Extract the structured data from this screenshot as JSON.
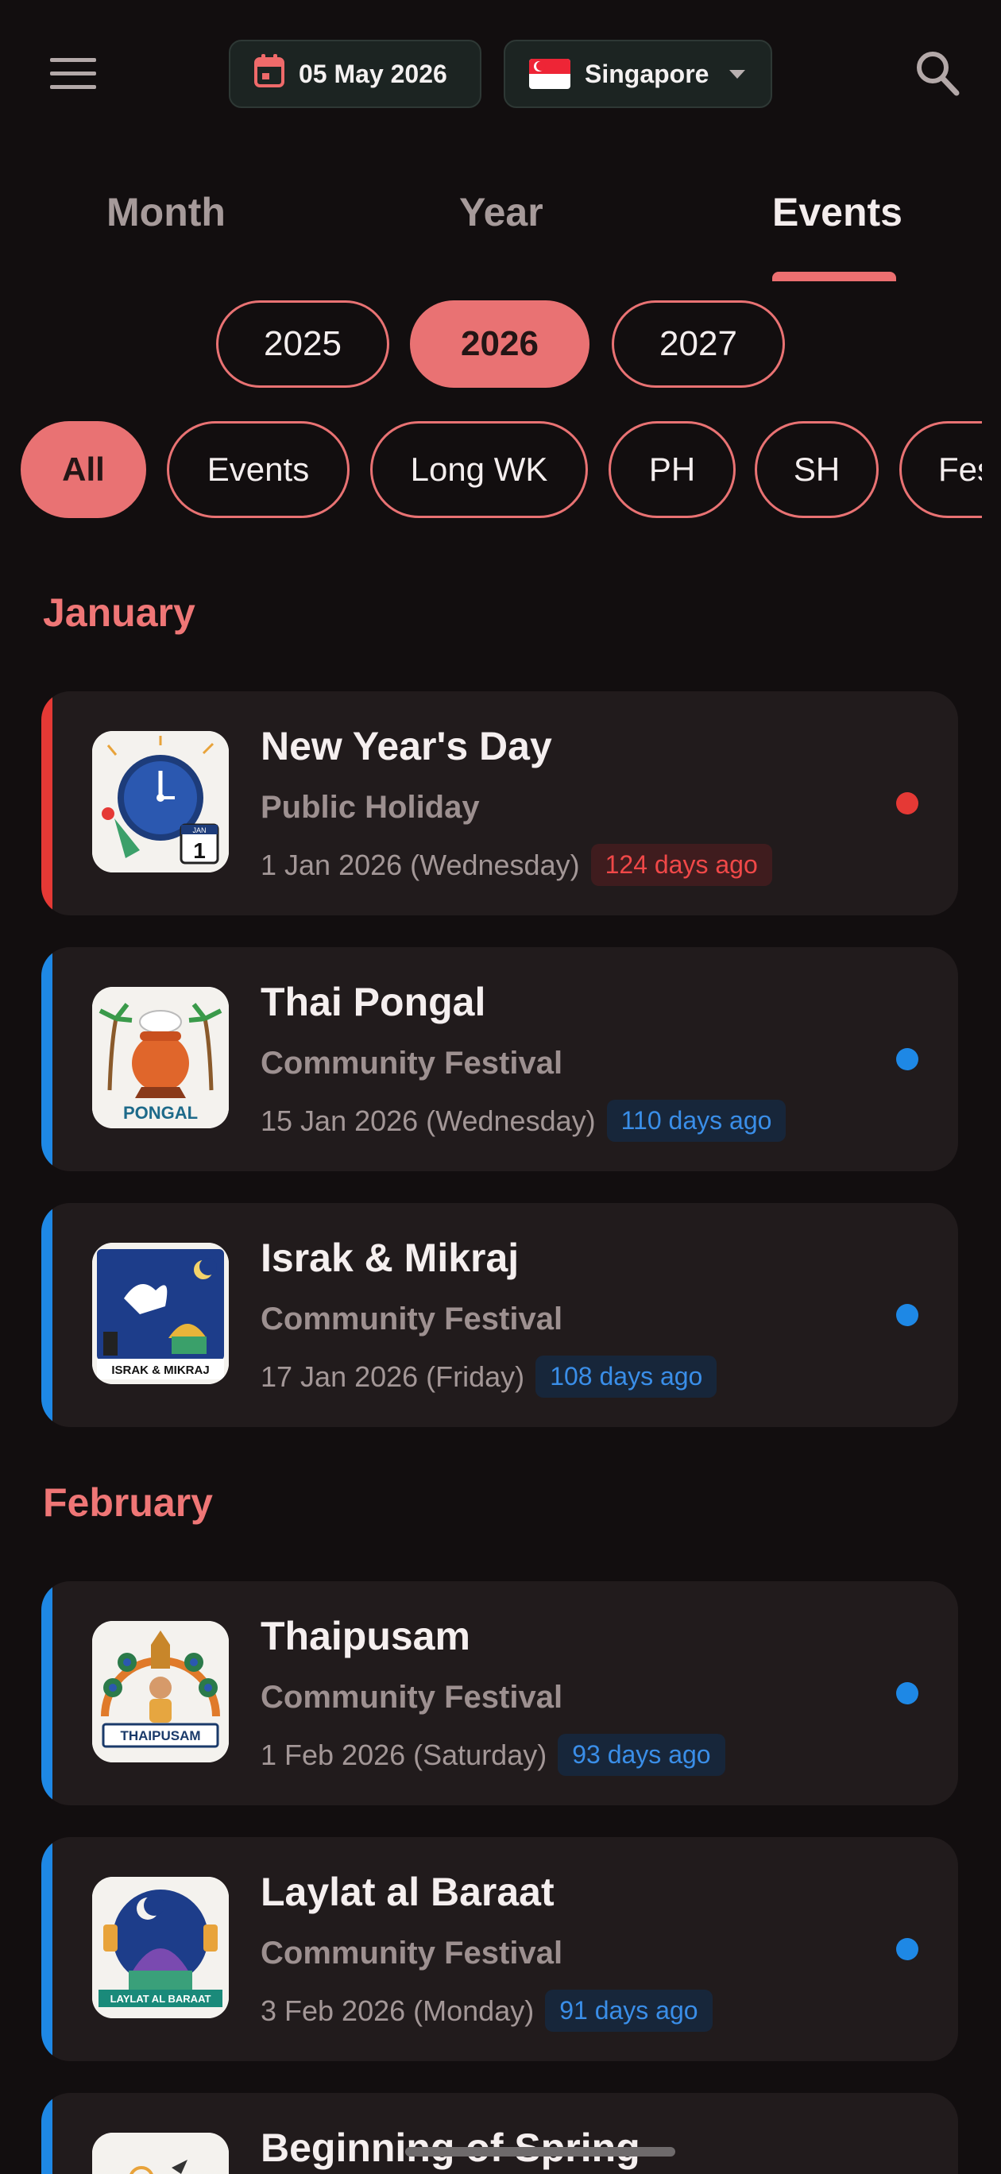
{
  "header": {
    "menu_icon": "menu-icon",
    "date_label": "05 May 2026",
    "calendar_icon": "calendar-icon",
    "country_label": "Singapore",
    "flag_icon": "singapore-flag-icon",
    "search_icon": "search-icon"
  },
  "tabs": [
    {
      "label": "Month"
    },
    {
      "label": "Year"
    },
    {
      "label": "Events",
      "active": true
    }
  ],
  "years": [
    {
      "label": "2025"
    },
    {
      "label": "2026",
      "selected": true
    },
    {
      "label": "2027"
    }
  ],
  "filters": [
    {
      "label": "All",
      "selected": true
    },
    {
      "label": "Events"
    },
    {
      "label": "Long WK"
    },
    {
      "label": "PH"
    },
    {
      "label": "SH"
    },
    {
      "label": "Fes"
    }
  ],
  "months": [
    {
      "name": "January",
      "events": [
        {
          "title": "New Year's Day",
          "type": "Public Holiday",
          "date": "1 Jan 2026 (Wednesday)",
          "ago": "124 days ago",
          "kind": "red",
          "thumb_text": "",
          "thumb_calendar_month": "JAN",
          "thumb_calendar_day": "1"
        },
        {
          "title": "Thai Pongal",
          "type": "Community Festival",
          "date": "15 Jan 2026 (Wednesday)",
          "ago": "110 days ago",
          "kind": "blue",
          "thumb_text": "PONGAL"
        },
        {
          "title": "Israk & Mikraj",
          "type": "Community Festival",
          "date": "17 Jan 2026 (Friday)",
          "ago": "108 days ago",
          "kind": "blue",
          "thumb_text": "ISRAK & MIKRAJ"
        }
      ]
    },
    {
      "name": "February",
      "events": [
        {
          "title": "Thaipusam",
          "type": "Community Festival",
          "date": "1 Feb 2026 (Saturday)",
          "ago": "93 days ago",
          "kind": "blue",
          "thumb_text": "THAIPUSAM"
        },
        {
          "title": "Laylat al Baraat",
          "type": "Community Festival",
          "date": "3 Feb 2026 (Monday)",
          "ago": "91 days ago",
          "kind": "blue",
          "thumb_text": "LAYLAT AL BARAAT"
        },
        {
          "title": "Beginning of Spring",
          "type": "",
          "date": "",
          "ago": "",
          "kind": "blue",
          "thumb_text": ""
        }
      ]
    }
  ],
  "colors": {
    "accent": "#e97273",
    "public_holiday": "#e53935",
    "festival": "#1e88e5",
    "background": "#120e0f",
    "card": "#211b1c"
  }
}
